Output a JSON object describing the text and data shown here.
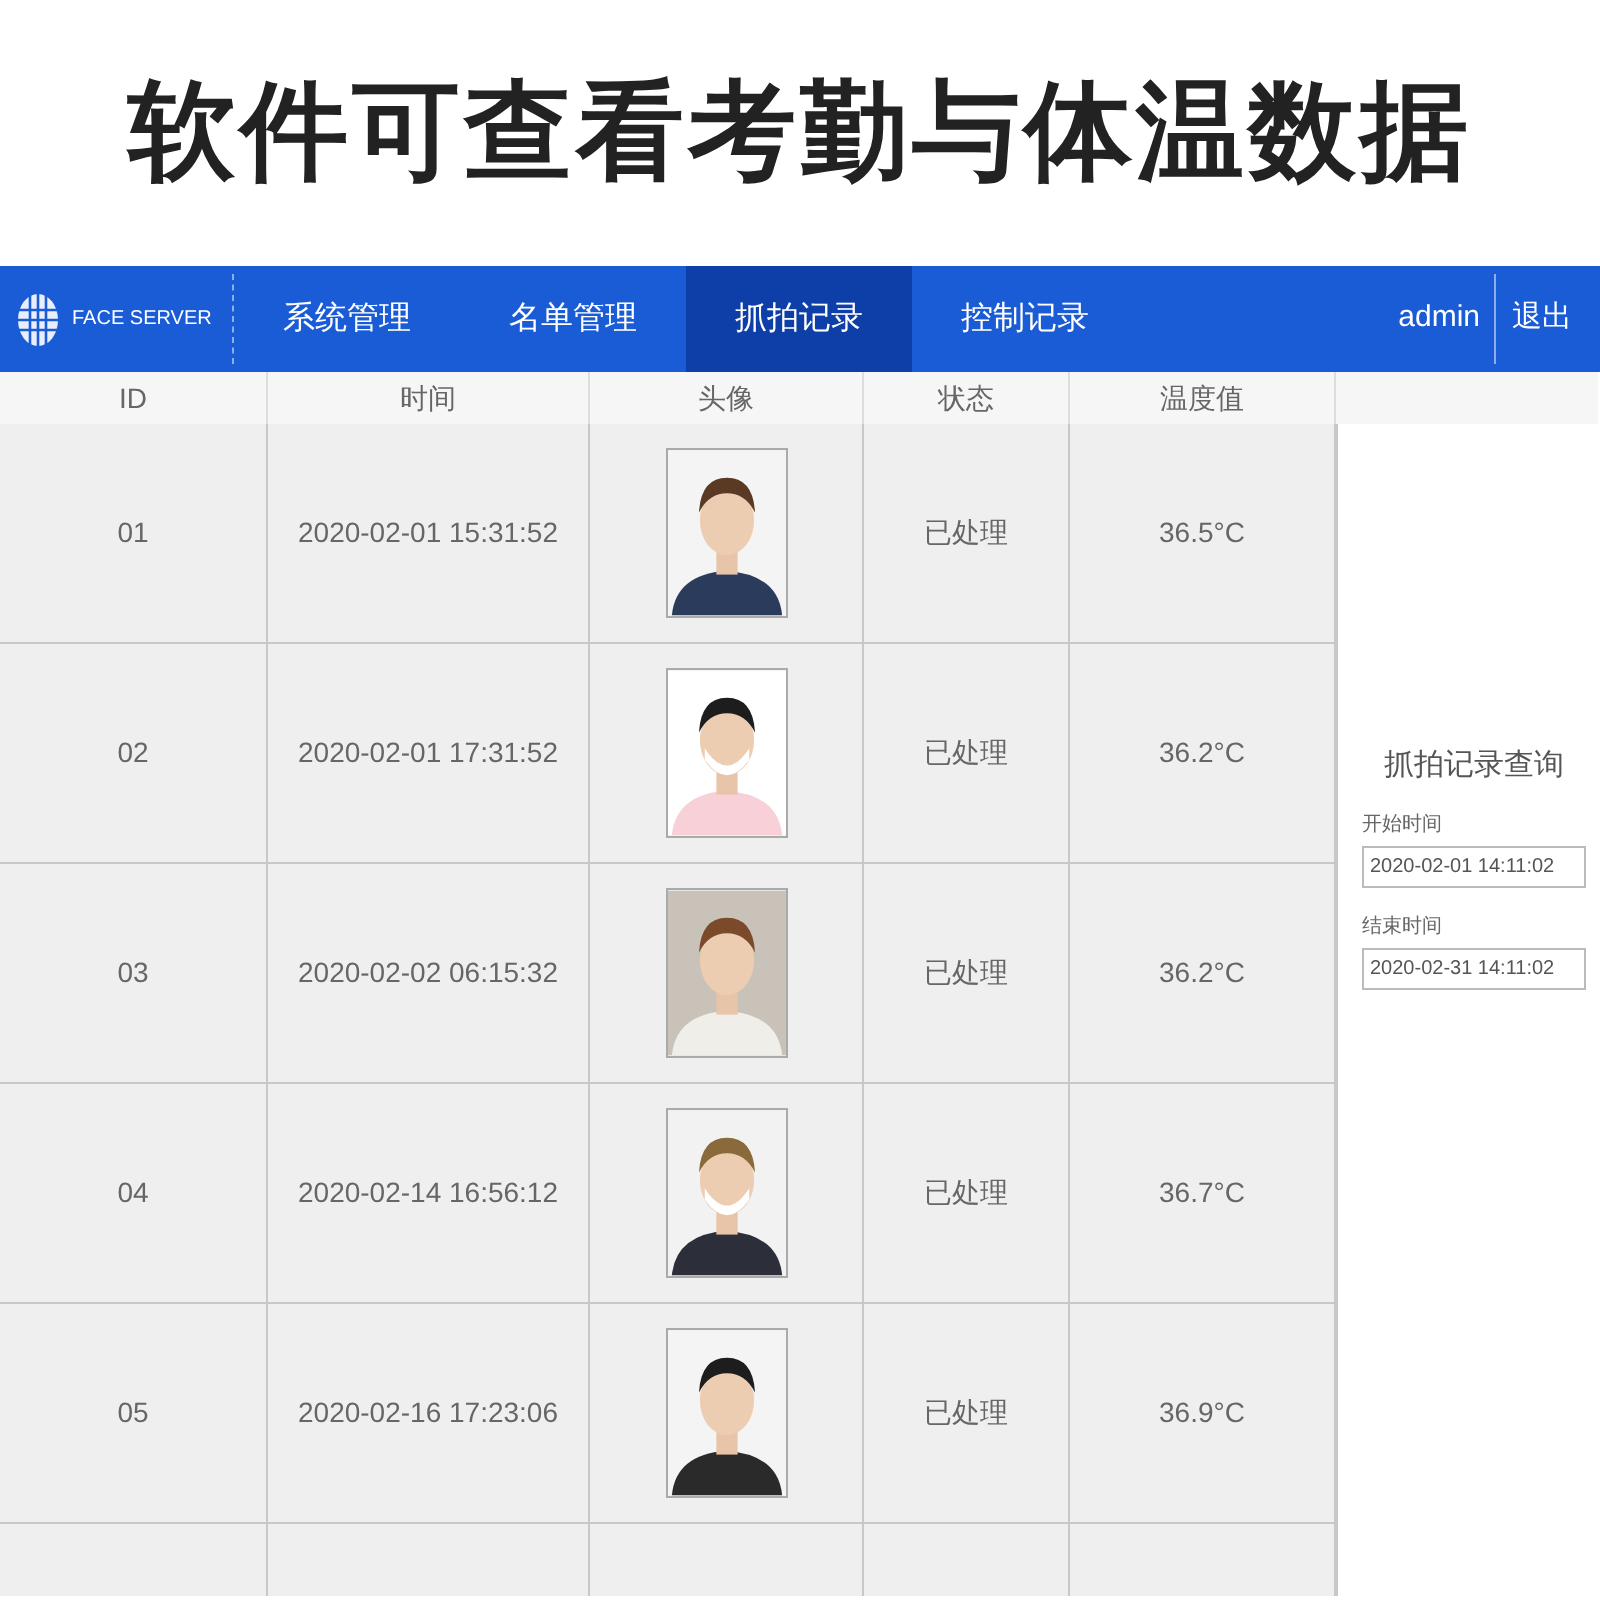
{
  "headline": "软件可查看考勤与体温数据",
  "navbar": {
    "brand": "FACE SERVER",
    "tabs": [
      {
        "label": "系统管理",
        "selected": false
      },
      {
        "label": "名单管理",
        "selected": false
      },
      {
        "label": "抓拍记录",
        "selected": true
      },
      {
        "label": "控制记录",
        "selected": false
      }
    ],
    "user": "admin",
    "logout": "退出"
  },
  "table": {
    "columns": [
      "ID",
      "时间",
      "头像",
      "状态",
      "温度值"
    ],
    "rows": [
      {
        "id": "01",
        "time": "2020-02-01 15:31:52",
        "status": "已处理",
        "temperature": "36.5°C"
      },
      {
        "id": "02",
        "time": "2020-02-01 17:31:52",
        "status": "已处理",
        "temperature": "36.2°C"
      },
      {
        "id": "03",
        "time": "2020-02-02 06:15:32",
        "status": "已处理",
        "temperature": "36.2°C"
      },
      {
        "id": "04",
        "time": "2020-02-14 16:56:12",
        "status": "已处理",
        "temperature": "36.7°C"
      },
      {
        "id": "05",
        "time": "2020-02-16 17:23:06",
        "status": "已处理",
        "temperature": "36.9°C"
      }
    ]
  },
  "query_panel": {
    "title": "抓拍记录查询",
    "fields": [
      {
        "label": "开始时间",
        "value": "2020-02-01 14:11:02"
      },
      {
        "label": "结束时间",
        "value": "2020-02-31 14:11:02"
      }
    ]
  }
}
